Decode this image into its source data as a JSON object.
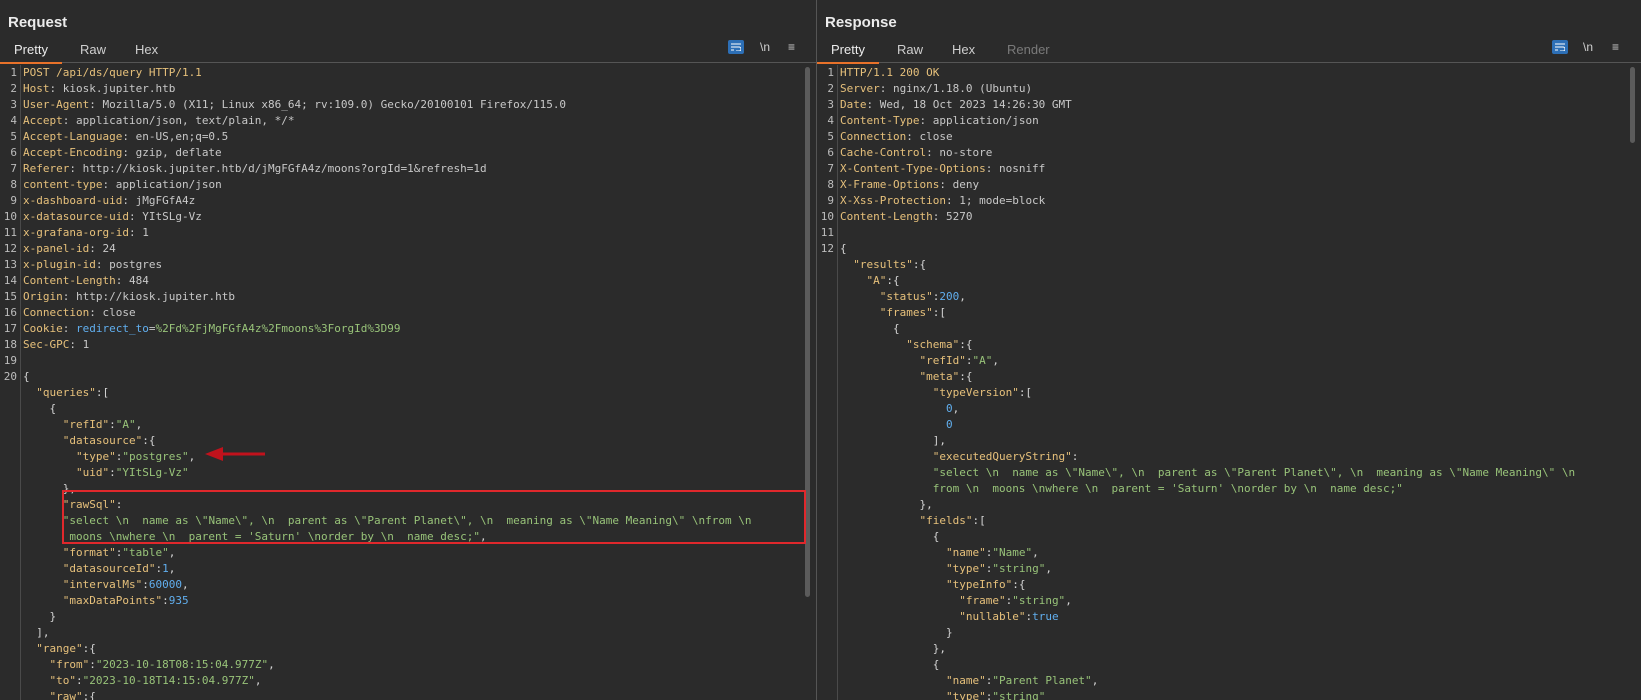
{
  "request": {
    "title": "Request",
    "tabs": [
      "Pretty",
      "Raw",
      "Hex"
    ],
    "newline_label": "\\n",
    "menu_icon": "≡",
    "lines": [
      [
        [
          "h",
          "POST /api/ds/query HTTP/1.1"
        ]
      ],
      [
        [
          "h",
          "Host"
        ],
        [
          "v",
          ": kiosk.jupiter.htb"
        ]
      ],
      [
        [
          "h",
          "User-Agent"
        ],
        [
          "v",
          ": Mozilla/5.0 (X11; Linux x86_64; rv:109.0) Gecko/20100101 Firefox/115.0"
        ]
      ],
      [
        [
          "h",
          "Accept"
        ],
        [
          "v",
          ": application/json, text/plain, */*"
        ]
      ],
      [
        [
          "h",
          "Accept-Language"
        ],
        [
          "v",
          ": en-US,en;q=0.5"
        ]
      ],
      [
        [
          "h",
          "Accept-Encoding"
        ],
        [
          "v",
          ": gzip, deflate"
        ]
      ],
      [
        [
          "h",
          "Referer"
        ],
        [
          "v",
          ": http://kiosk.jupiter.htb/d/jMgFGfA4z/moons?orgId=1&refresh=1d"
        ]
      ],
      [
        [
          "h",
          "content-type"
        ],
        [
          "v",
          ": application/json"
        ]
      ],
      [
        [
          "h",
          "x-dashboard-uid"
        ],
        [
          "v",
          ": jMgFGfA4z"
        ]
      ],
      [
        [
          "h",
          "x-datasource-uid"
        ],
        [
          "v",
          ": YItSLg-Vz"
        ]
      ],
      [
        [
          "h",
          "x-grafana-org-id"
        ],
        [
          "v",
          ": 1"
        ]
      ],
      [
        [
          "h",
          "x-panel-id"
        ],
        [
          "v",
          ": 24"
        ]
      ],
      [
        [
          "h",
          "x-plugin-id"
        ],
        [
          "v",
          ": postgres"
        ]
      ],
      [
        [
          "h",
          "Content-Length"
        ],
        [
          "v",
          ": 484"
        ]
      ],
      [
        [
          "h",
          "Origin"
        ],
        [
          "v",
          ": http://kiosk.jupiter.htb"
        ]
      ],
      [
        [
          "h",
          "Connection"
        ],
        [
          "v",
          ": close"
        ]
      ],
      [
        [
          "h",
          "Cookie"
        ],
        [
          "v",
          ": "
        ],
        [
          "n",
          "redirect_to"
        ],
        [
          "v",
          "="
        ],
        [
          "s",
          "%2Fd%2FjMgFGfA4z%2Fmoons%3ForgId%3D99"
        ]
      ],
      [
        [
          "h",
          "Sec-GPC"
        ],
        [
          "v",
          ": 1"
        ]
      ],
      [],
      [
        [
          "p",
          "{"
        ]
      ],
      [
        [
          "p",
          "  "
        ],
        [
          "k",
          "\"queries\""
        ],
        [
          "p",
          ":["
        ]
      ],
      [
        [
          "p",
          "    {"
        ]
      ],
      [
        [
          "p",
          "      "
        ],
        [
          "k",
          "\"refId\""
        ],
        [
          "p",
          ":"
        ],
        [
          "s",
          "\"A\""
        ],
        [
          "p",
          ","
        ]
      ],
      [
        [
          "p",
          "      "
        ],
        [
          "k",
          "\"datasource\""
        ],
        [
          "p",
          ":{"
        ]
      ],
      [
        [
          "p",
          "        "
        ],
        [
          "k",
          "\"type\""
        ],
        [
          "p",
          ":"
        ],
        [
          "s",
          "\"postgres\""
        ],
        [
          "p",
          ","
        ]
      ],
      [
        [
          "p",
          "        "
        ],
        [
          "k",
          "\"uid\""
        ],
        [
          "p",
          ":"
        ],
        [
          "s",
          "\"YItSLg-Vz\""
        ]
      ],
      [
        [
          "p",
          "      },"
        ]
      ],
      [
        [
          "p",
          "      "
        ],
        [
          "k",
          "\"rawSql\""
        ],
        [
          "p",
          ":"
        ]
      ],
      [
        [
          "p",
          "      "
        ],
        [
          "s",
          "\"select \\n  name as \\\"Name\\\", \\n  parent as \\\"Parent Planet\\\", \\n  meaning as \\\"Name Meaning\\\" \\nfrom \\n"
        ]
      ],
      [
        [
          "p",
          "       "
        ],
        [
          "s",
          "moons \\nwhere \\n  parent = 'Saturn' \\norder by \\n  name desc;\""
        ],
        [
          "p",
          ","
        ]
      ],
      [
        [
          "p",
          "      "
        ],
        [
          "k",
          "\"format\""
        ],
        [
          "p",
          ":"
        ],
        [
          "s",
          "\"table\""
        ],
        [
          "p",
          ","
        ]
      ],
      [
        [
          "p",
          "      "
        ],
        [
          "k",
          "\"datasourceId\""
        ],
        [
          "p",
          ":"
        ],
        [
          "n",
          "1"
        ],
        [
          "p",
          ","
        ]
      ],
      [
        [
          "p",
          "      "
        ],
        [
          "k",
          "\"intervalMs\""
        ],
        [
          "p",
          ":"
        ],
        [
          "n",
          "60000"
        ],
        [
          "p",
          ","
        ]
      ],
      [
        [
          "p",
          "      "
        ],
        [
          "k",
          "\"maxDataPoints\""
        ],
        [
          "p",
          ":"
        ],
        [
          "n",
          "935"
        ]
      ],
      [
        [
          "p",
          "    }"
        ]
      ],
      [
        [
          "p",
          "  ],"
        ]
      ],
      [
        [
          "p",
          "  "
        ],
        [
          "k",
          "\"range\""
        ],
        [
          "p",
          ":{"
        ]
      ],
      [
        [
          "p",
          "    "
        ],
        [
          "k",
          "\"from\""
        ],
        [
          "p",
          ":"
        ],
        [
          "s",
          "\"2023-10-18T08:15:04.977Z\""
        ],
        [
          "p",
          ","
        ]
      ],
      [
        [
          "p",
          "    "
        ],
        [
          "k",
          "\"to\""
        ],
        [
          "p",
          ":"
        ],
        [
          "s",
          "\"2023-10-18T14:15:04.977Z\""
        ],
        [
          "p",
          ","
        ]
      ],
      [
        [
          "p",
          "    "
        ],
        [
          "k",
          "\"raw\""
        ],
        [
          "p",
          ":{"
        ]
      ]
    ],
    "line_numbers": [
      "1",
      "2",
      "3",
      "4",
      "5",
      "6",
      "7",
      "8",
      "9",
      "10",
      "11",
      "12",
      "13",
      "14",
      "15",
      "16",
      "17",
      "18",
      "19",
      "20"
    ]
  },
  "response": {
    "title": "Response",
    "tabs": [
      "Pretty",
      "Raw",
      "Hex",
      "Render"
    ],
    "newline_label": "\\n",
    "menu_icon": "≡",
    "lines": [
      [
        [
          "h",
          "HTTP/1.1 200 OK"
        ]
      ],
      [
        [
          "h",
          "Server"
        ],
        [
          "v",
          ": nginx/1.18.0 (Ubuntu)"
        ]
      ],
      [
        [
          "h",
          "Date"
        ],
        [
          "v",
          ": Wed, 18 Oct 2023 14:26:30 GMT"
        ]
      ],
      [
        [
          "h",
          "Content-Type"
        ],
        [
          "v",
          ": application/json"
        ]
      ],
      [
        [
          "h",
          "Connection"
        ],
        [
          "v",
          ": close"
        ]
      ],
      [
        [
          "h",
          "Cache-Control"
        ],
        [
          "v",
          ": no-store"
        ]
      ],
      [
        [
          "h",
          "X-Content-Type-Options"
        ],
        [
          "v",
          ": nosniff"
        ]
      ],
      [
        [
          "h",
          "X-Frame-Options"
        ],
        [
          "v",
          ": deny"
        ]
      ],
      [
        [
          "h",
          "X-Xss-Protection"
        ],
        [
          "v",
          ": 1; mode=block"
        ]
      ],
      [
        [
          "h",
          "Content-Length"
        ],
        [
          "v",
          ": 5270"
        ]
      ],
      [],
      [
        [
          "p",
          "{"
        ]
      ],
      [
        [
          "p",
          "  "
        ],
        [
          "k",
          "\"results\""
        ],
        [
          "p",
          ":{"
        ]
      ],
      [
        [
          "p",
          "    "
        ],
        [
          "k",
          "\"A\""
        ],
        [
          "p",
          ":{"
        ]
      ],
      [
        [
          "p",
          "      "
        ],
        [
          "k",
          "\"status\""
        ],
        [
          "p",
          ":"
        ],
        [
          "n",
          "200"
        ],
        [
          "p",
          ","
        ]
      ],
      [
        [
          "p",
          "      "
        ],
        [
          "k",
          "\"frames\""
        ],
        [
          "p",
          ":["
        ]
      ],
      [
        [
          "p",
          "        {"
        ]
      ],
      [
        [
          "p",
          "          "
        ],
        [
          "k",
          "\"schema\""
        ],
        [
          "p",
          ":{"
        ]
      ],
      [
        [
          "p",
          "            "
        ],
        [
          "k",
          "\"refId\""
        ],
        [
          "p",
          ":"
        ],
        [
          "s",
          "\"A\""
        ],
        [
          "p",
          ","
        ]
      ],
      [
        [
          "p",
          "            "
        ],
        [
          "k",
          "\"meta\""
        ],
        [
          "p",
          ":{"
        ]
      ],
      [
        [
          "p",
          "              "
        ],
        [
          "k",
          "\"typeVersion\""
        ],
        [
          "p",
          ":["
        ]
      ],
      [
        [
          "p",
          "                "
        ],
        [
          "n",
          "0"
        ],
        [
          "p",
          ","
        ]
      ],
      [
        [
          "p",
          "                "
        ],
        [
          "n",
          "0"
        ]
      ],
      [
        [
          "p",
          "              ],"
        ]
      ],
      [
        [
          "p",
          "              "
        ],
        [
          "k",
          "\"executedQueryString\""
        ],
        [
          "p",
          ":"
        ]
      ],
      [
        [
          "p",
          "              "
        ],
        [
          "s",
          "\"select \\n  name as \\\"Name\\\", \\n  parent as \\\"Parent Planet\\\", \\n  meaning as \\\"Name Meaning\\\" \\n"
        ]
      ],
      [
        [
          "p",
          "              "
        ],
        [
          "s",
          "from \\n  moons \\nwhere \\n  parent = 'Saturn' \\norder by \\n  name desc;\""
        ]
      ],
      [
        [
          "p",
          "            },"
        ]
      ],
      [
        [
          "p",
          "            "
        ],
        [
          "k",
          "\"fields\""
        ],
        [
          "p",
          ":["
        ]
      ],
      [
        [
          "p",
          "              {"
        ]
      ],
      [
        [
          "p",
          "                "
        ],
        [
          "k",
          "\"name\""
        ],
        [
          "p",
          ":"
        ],
        [
          "s",
          "\"Name\""
        ],
        [
          "p",
          ","
        ]
      ],
      [
        [
          "p",
          "                "
        ],
        [
          "k",
          "\"type\""
        ],
        [
          "p",
          ":"
        ],
        [
          "s",
          "\"string\""
        ],
        [
          "p",
          ","
        ]
      ],
      [
        [
          "p",
          "                "
        ],
        [
          "k",
          "\"typeInfo\""
        ],
        [
          "p",
          ":{"
        ]
      ],
      [
        [
          "p",
          "                  "
        ],
        [
          "k",
          "\"frame\""
        ],
        [
          "p",
          ":"
        ],
        [
          "s",
          "\"string\""
        ],
        [
          "p",
          ","
        ]
      ],
      [
        [
          "p",
          "                  "
        ],
        [
          "k",
          "\"nullable\""
        ],
        [
          "p",
          ":"
        ],
        [
          "n",
          "true"
        ]
      ],
      [
        [
          "p",
          "                }"
        ]
      ],
      [
        [
          "p",
          "              },"
        ]
      ],
      [
        [
          "p",
          "              {"
        ]
      ],
      [
        [
          "p",
          "                "
        ],
        [
          "k",
          "\"name\""
        ],
        [
          "p",
          ":"
        ],
        [
          "s",
          "\"Parent Planet\""
        ],
        [
          "p",
          ","
        ]
      ],
      [
        [
          "p",
          "                "
        ],
        [
          "k",
          "\"type\""
        ],
        [
          "p",
          ":"
        ],
        [
          "s",
          "\"string\""
        ]
      ]
    ],
    "line_numbers": [
      "1",
      "2",
      "3",
      "4",
      "5",
      "6",
      "7",
      "8",
      "9",
      "10",
      "11",
      "12"
    ]
  },
  "colors": {
    "accent": "#e8722a",
    "highlight": "#e0282c",
    "button_blue": "#2d6fb6"
  }
}
